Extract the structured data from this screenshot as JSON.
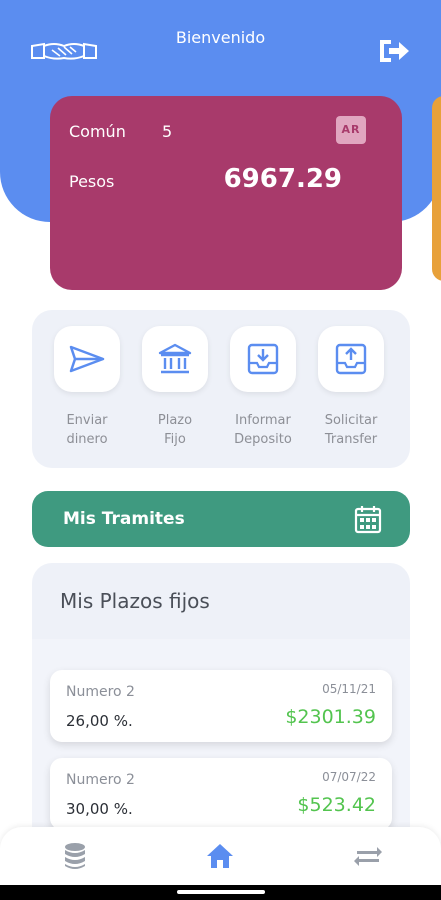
{
  "header": {
    "title": "Bienvenido"
  },
  "account": {
    "type": "Común",
    "number": "5",
    "badge": "AR",
    "currency": "Pesos",
    "balance": "6967.29"
  },
  "actions": [
    {
      "label_line1": "Enviar",
      "label_line2": "dinero",
      "icon": "send-icon"
    },
    {
      "label_line1": "Plazo",
      "label_line2": "Fijo",
      "icon": "bank-icon"
    },
    {
      "label_line1": "Informar",
      "label_line2": "Deposito",
      "icon": "inbox-download-icon"
    },
    {
      "label_line1": "Solicitar",
      "label_line2": "Transfer",
      "icon": "inbox-upload-icon"
    }
  ],
  "tramites": {
    "label": "Mis Tramites",
    "icon": "calendar-icon"
  },
  "plazos": {
    "title": "Mis Plazos fijos",
    "items": [
      {
        "name": "Numero 2",
        "date": "05/11/21",
        "rate": "26,00 %.",
        "amount": "$2301.39"
      },
      {
        "name": "Numero 2",
        "date": "07/07/22",
        "rate": "30,00 %.",
        "amount": "$523.42"
      }
    ]
  },
  "nav": {
    "items": [
      "database-icon",
      "home-icon",
      "transfer-arrows-icon"
    ],
    "active": "home-icon"
  },
  "colors": {
    "header": "#5b8df0",
    "card": "#a83a6b",
    "tramites": "#3f9a80",
    "amount": "#53c44f",
    "icon": "#5b8df0"
  }
}
